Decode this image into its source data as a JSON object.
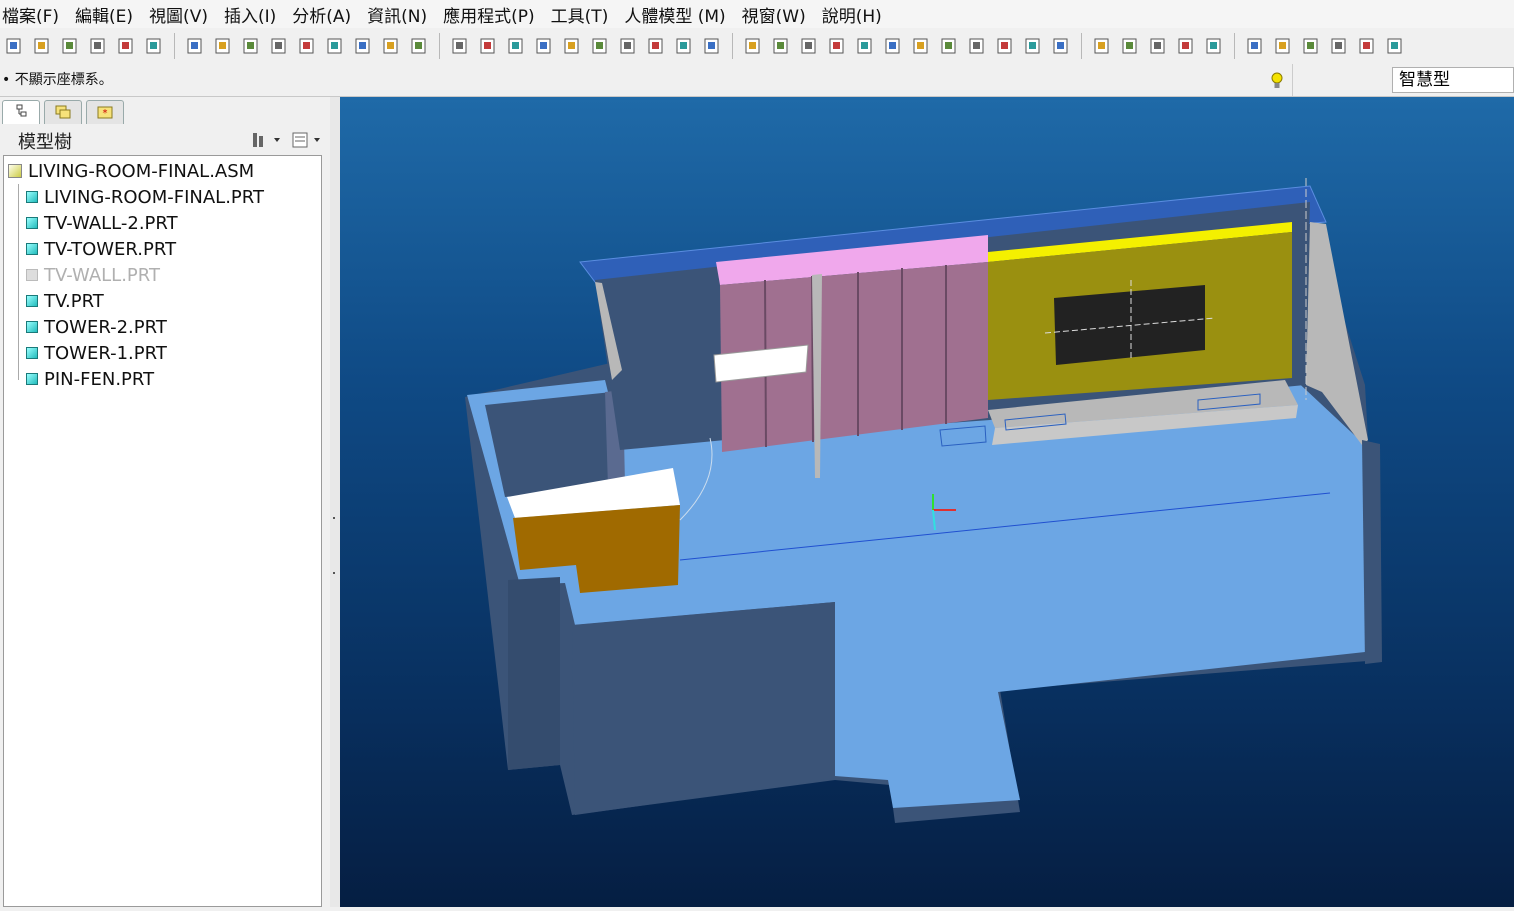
{
  "menu": [
    "檔案(F)",
    "編輯(E)",
    "視圖(V)",
    "插入(I)",
    "分析(A)",
    "資訊(N)",
    "應用程式(P)",
    "工具(T)",
    "人體模型 (M)",
    "視窗(W)",
    "說明(H)"
  ],
  "toolbar_icons": [
    "new-icon",
    "open-icon",
    "regenerate-icon",
    "save-copy-icon",
    "folder-icon",
    "link-icon",
    "window-check-icon",
    "window-close-icon",
    "window-multi-icon",
    "new-file-icon",
    "open-folder-icon",
    "save-icon",
    "print-icon",
    "print-preview-icon",
    "email-icon",
    "undo-icon",
    "redo-icon",
    "cut-icon",
    "copy-icon",
    "paste-icon",
    "paste-special-icon",
    "move-icon",
    "copy-move-icon",
    "find-icon",
    "select-box-icon",
    "sketch-icon",
    "datum-icon",
    "spin-center-icon",
    "shading-icon",
    "pan-icon",
    "zoom-in-icon",
    "zoom-out-icon",
    "refit-icon",
    "orient-icon",
    "saved-views-icon",
    "layers-icon",
    "appearance-icon",
    "wireframe-icon",
    "hidden-line-icon",
    "no-hidden-icon",
    "shaded-icon",
    "enhanced-icon",
    "datum-planes-icon",
    "datum-axes-icon",
    "datum-points-icon",
    "coord-sys-icon",
    "annotations-icon",
    "context-help-icon"
  ],
  "message": "• 不顯示座標系。",
  "filter": "智慧型",
  "model_tree": {
    "title": "模型樹",
    "root": "LIVING-ROOM-FINAL.ASM",
    "items": [
      {
        "label": "LIVING-ROOM-FINAL.PRT",
        "suppressed": false
      },
      {
        "label": "TV-WALL-2.PRT",
        "suppressed": false
      },
      {
        "label": "TV-TOWER.PRT",
        "suppressed": false
      },
      {
        "label": "TV-WALL.PRT",
        "suppressed": true
      },
      {
        "label": "TV.PRT",
        "suppressed": false
      },
      {
        "label": "TOWER-2.PRT",
        "suppressed": false
      },
      {
        "label": "TOWER-1.PRT",
        "suppressed": false
      },
      {
        "label": "PIN-FEN.PRT",
        "suppressed": false
      }
    ]
  },
  "colors": {
    "floor": "#6ca6e4",
    "wall_dark": "#3b5478",
    "wall_side": "#b8b8b8",
    "cabinet": "#a07090",
    "cabinet_top": "#f0a8ec",
    "tv_wall": "#9a9010",
    "tv_wall_top": "#f4f000",
    "tv": "#222222",
    "counter": "#a06a00",
    "counter_top": "#ffffff"
  }
}
